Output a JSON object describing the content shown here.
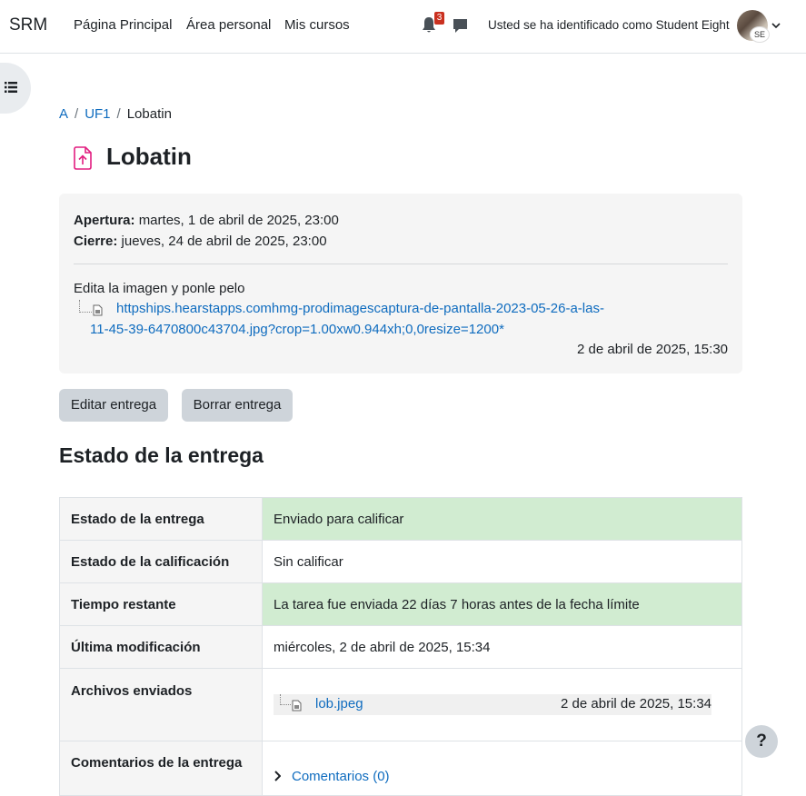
{
  "navbar": {
    "brand": "SRM",
    "links": [
      "Página Principal",
      "Área personal",
      "Mis cursos"
    ],
    "notification_count": "3",
    "user_text": "Usted se ha identificado como Student Eight",
    "avatar_initials": "SE"
  },
  "breadcrumb": [
    "A",
    "UF1",
    "Lobatin"
  ],
  "page": {
    "title": "Lobatin",
    "accent_color": "#e21e80"
  },
  "assignment": {
    "opening_label": "Apertura:",
    "opening_value": "martes, 1 de abril de 2025, 23:00",
    "closing_label": "Cierre:",
    "closing_value": "jueves, 24 de abril de 2025, 23:00",
    "intro": "Edita la imagen y ponle pelo",
    "attachment_name": "httpships.hearstapps.comhmg-prodimagescaptura-de-pantalla-2023-05-26-a-las-11-45-39-6470800c43704.jpg?crop=1.00xw0.944xh;0,0resize=1200*",
    "attachment_date": "2 de abril de 2025, 15:30"
  },
  "actions": {
    "edit": "Editar entrega",
    "delete": "Borrar entrega"
  },
  "status": {
    "heading": "Estado de la entrega",
    "rows": {
      "submission_status": {
        "label": "Estado de la entrega",
        "value": "Enviado para calificar"
      },
      "grading_status": {
        "label": "Estado de la calificación",
        "value": "Sin calificar"
      },
      "time_remaining": {
        "label": "Tiempo restante",
        "value": "La tarea fue enviada 22 días 7 horas antes de la fecha límite"
      },
      "last_modified": {
        "label": "Última modificación",
        "value": "miércoles, 2 de abril de 2025, 15:34"
      },
      "files": {
        "label": "Archivos enviados",
        "file_name": "lob.jpeg",
        "file_date": "2 de abril de 2025, 15:34"
      },
      "comments": {
        "label": "Comentarios de la entrega",
        "link": "Comentarios (0)"
      }
    },
    "success_color": "#d1ecd1"
  },
  "help": {
    "label": "?"
  }
}
